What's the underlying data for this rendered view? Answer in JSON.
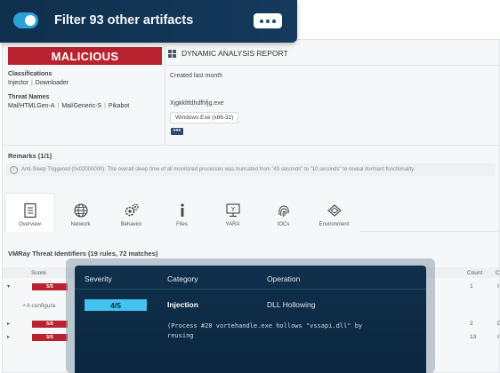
{
  "filter": {
    "label": "Filter 93 other artifacts",
    "toggle_on": true
  },
  "verdict": "MALICIOUS",
  "classifications": {
    "label": "Classifications",
    "values": [
      "Injector",
      "Downloader"
    ]
  },
  "threat_names": {
    "label": "Threat Names",
    "values": [
      "Mal/HTMLGen-A",
      "Mal/Generic-S",
      "Pikabot"
    ]
  },
  "report": {
    "title": "DYNAMIC ANALYSIS REPORT",
    "created": "Created last month",
    "filename": "Xjgkkltfdhdfhfjg.exe",
    "filetype": "Windows Exe (x86-32)"
  },
  "remarks": {
    "title": "Remarks (1/1)",
    "text": "Anti-Sleep Triggered (0x02000000): The overall sleep time of all monitored processes was truncated from \"43 seconds\" to \"10 seconds\" to reveal dormant functionality."
  },
  "tabs": [
    {
      "label": "Overview",
      "icon": "document-icon",
      "active": true
    },
    {
      "label": "Network",
      "icon": "globe-icon"
    },
    {
      "label": "Behavior",
      "icon": "gears-icon"
    },
    {
      "label": "Files",
      "icon": "info-icon"
    },
    {
      "label": "YARA",
      "icon": "yara-icon"
    },
    {
      "label": "IOCs",
      "icon": "fingerprint-icon"
    },
    {
      "label": "Environment",
      "icon": "box-icon"
    }
  ],
  "vti": {
    "title": "VMRay Threat Identifiers (19 rules, 72 matches)",
    "col_score": "Score",
    "col_count": "Count",
    "col_c": "C",
    "rows": [
      {
        "score": "5/5",
        "count": "1",
        "c2": "I",
        "caret": "▾"
      },
      {
        "score": "5/5",
        "count": "2",
        "c2": "D",
        "caret": "▸"
      },
      {
        "score": "5/5",
        "count": "13",
        "c2": "I",
        "caret": "▸"
      }
    ],
    "config_text": "A configura"
  },
  "popup": {
    "col_severity": "Severity",
    "col_category": "Category",
    "col_operation": "Operation",
    "severity": "4/5",
    "category": "Injection",
    "operation": "DLL Hollowing",
    "detail_line1": "(Process #20 vortehandle.exe hollows \"vssapi.dll\" by",
    "detail_line2": "reusing"
  },
  "colors": {
    "malicious": "#b8232f",
    "accent": "#44c2f0",
    "overlay_dark": "#0f2f4b"
  }
}
